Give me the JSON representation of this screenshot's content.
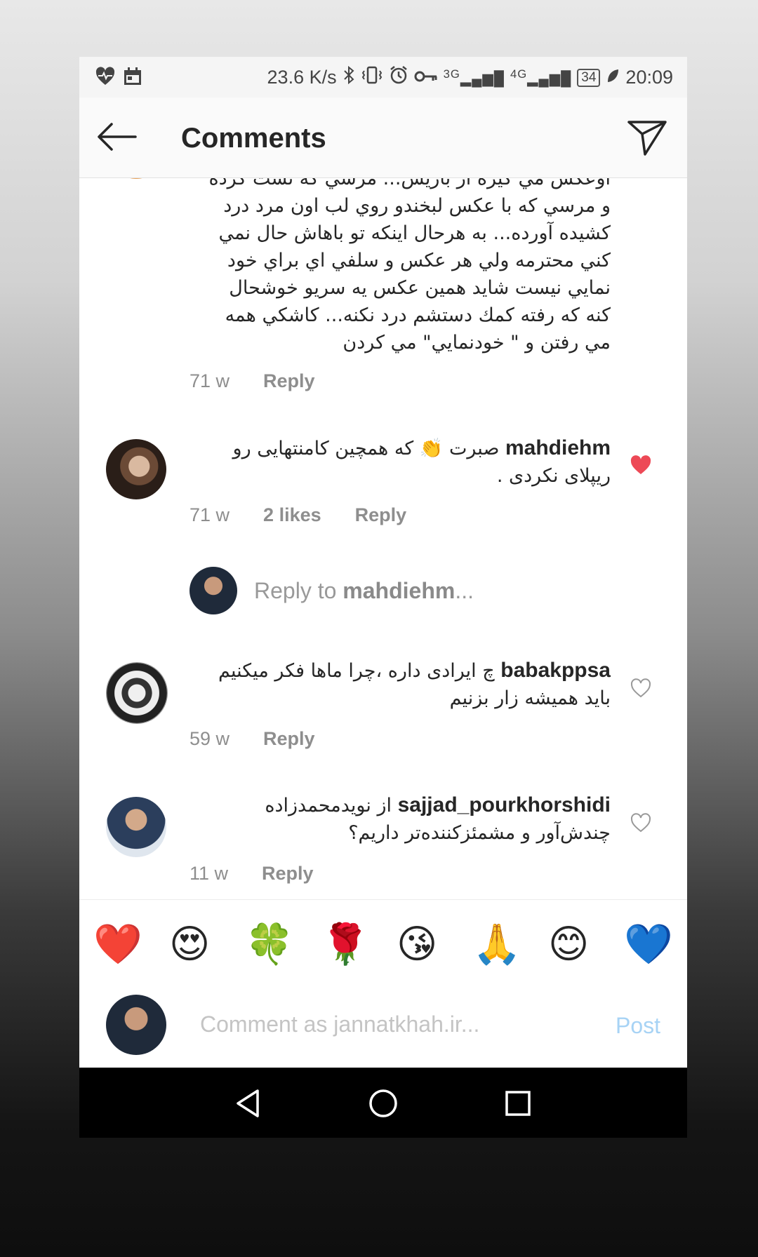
{
  "statusbar": {
    "speed": "23.6 K/s",
    "net1": "3G",
    "net2": "4G",
    "battery": "34",
    "time": "20:09"
  },
  "header": {
    "title": "Comments",
    "back_icon": "arrow-left-icon",
    "send_icon": "paper-plane-icon"
  },
  "comments": [
    {
      "text_lines": [
        "اوعکس مي گيره از بازيش... مرسي كه نست كرده",
        "و مرسي كه با عكس لبخندو روي لب اون مرد درد",
        "كشيده آورده... به هرحال اينكه تو باهاش حال نمي",
        "كني محترمه ولي هر عكس و سلفي اي براي خود",
        "نمايي نيست شايد همين عكس يه سريو خوشحال",
        "كنه كه رفته كمك دستشم درد نكنه... كاشكي همه",
        "مي رفتن و \" خودنمايي\" مي كردن"
      ],
      "time": "71 w",
      "reply": "Reply"
    },
    {
      "username": "mahdiehm",
      "text": "صبرت 👏 كه همچين كامنتهايى رو ريپلاى نكردى .",
      "time": "71 w",
      "likes": "2 likes",
      "reply": "Reply",
      "liked": true
    },
    {
      "username": "babakppsa",
      "text": "چ ایرادی داره ،چرا ماها فکر میکنیم باید همیشه زار بزنیم",
      "time": "59 w",
      "reply": "Reply",
      "liked": false
    },
    {
      "username": "sajjad_pourkhorshidi",
      "text": "از نویدمحمدزاده چندش‌آور و مشمئزکننده‌تر داریم؟",
      "time": "11 w",
      "reply": "Reply",
      "liked": false
    }
  ],
  "reply_box": {
    "prefix": "Reply to ",
    "target": "mahdiehm",
    "suffix": "..."
  },
  "emoji_bar": [
    "❤️",
    "😍",
    "🍀",
    "🌹",
    "😘",
    "🙏",
    "😊",
    "💙"
  ],
  "composer": {
    "placeholder": "Comment as jannatkhah.ir...",
    "post_label": "Post"
  },
  "colors": {
    "like_red": "#ed4956",
    "post_blue": "#a7d3f5",
    "meta_gray": "#8e8e8e"
  }
}
